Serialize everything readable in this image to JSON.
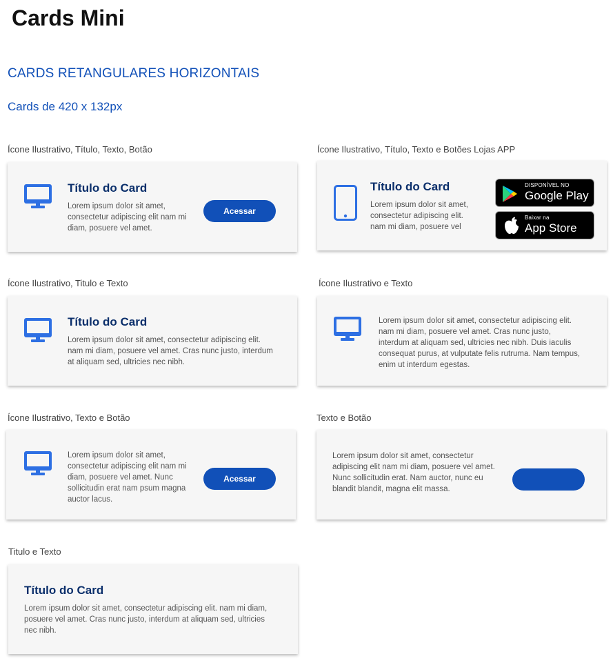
{
  "page": {
    "title": "Cards Mini",
    "section_title": "CARDS RETANGULARES HORIZONTAIS",
    "section_subtitle": "Cards de 420 x 132px"
  },
  "colors": {
    "accent": "#1150b8",
    "title": "#0b2f6b",
    "icon": "#2d6fe3",
    "card_bg": "#f6f6f6"
  },
  "cards": {
    "c1": {
      "caption": "Ícone Ilustrativo, Título, Texto, Botão",
      "icon": "monitor-icon",
      "title": "Título do Card",
      "text": "Lorem ipsum dolor sit amet, consectetur adipiscing elit nam mi diam, posuere vel amet.",
      "button": "Acessar"
    },
    "c2": {
      "caption": "Ícone Ilustrativo, Título, Texto e Botões Lojas APP",
      "icon": "smartphone-icon",
      "title": "Título do Card",
      "text": "Lorem ipsum dolor sit amet, consectetur adipiscing elit. nam mi diam, posuere vel",
      "google_play": {
        "small": "DISPONÍVEL NO",
        "big": "Google Play"
      },
      "app_store": {
        "small": "Baixar na",
        "big": "App Store"
      }
    },
    "c3": {
      "caption": "Ícone Ilustrativo, Titulo e Texto",
      "icon": "monitor-icon",
      "title": "Título do Card",
      "text": "Lorem ipsum dolor sit amet, consectetur adipiscing elit. nam mi diam, posuere vel amet. Cras nunc justo, interdum at aliquam sed, ultricies nec nibh."
    },
    "c4": {
      "caption": "Ícone Ilustrativo e Texto",
      "icon": "monitor-icon",
      "text": "Lorem ipsum dolor sit amet, consectetur adipiscing elit. nam mi diam, posuere vel amet. Cras nunc justo, interdum at aliquam sed, ultricies nec nibh. Duis iaculis consequat purus, at vulputate felis rutruma. Nam tempus, enim ut interdum egestas."
    },
    "c5": {
      "caption": "Ícone Ilustrativo, Texto e Botão",
      "icon": "monitor-icon",
      "text": "Lorem ipsum dolor sit amet, consectetur adipiscing elit nam mi diam, posuere vel amet. Nunc sollicitudin erat nam psum magna auctor lacus.",
      "button": "Acessar"
    },
    "c6": {
      "caption": "Texto e Botão",
      "text": "Lorem ipsum dolor sit amet, consectetur adipiscing elit nam mi diam, posuere vel amet. Nunc sollicitudin erat. Nam auctor, nunc eu blandit blandit, magna elit massa.",
      "button": ""
    },
    "c7": {
      "caption": "Titulo e Texto",
      "title": "Título do Card",
      "text": "Lorem ipsum dolor sit amet, consectetur adipiscing elit. nam mi diam, posuere vel amet. Cras nunc justo, interdum at aliquam sed, ultricies nec nibh."
    }
  }
}
